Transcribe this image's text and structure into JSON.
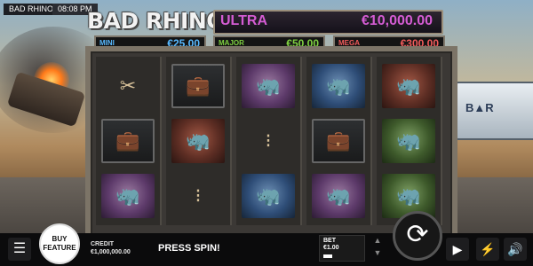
{
  "game": {
    "title": "BAD RHINOS",
    "time": "08:08 PM",
    "logo": "BAD RHINOS"
  },
  "jackpots": {
    "ultra": {
      "label": "ULTRA",
      "value": "€10,000.00"
    },
    "mini": {
      "label": "MINI",
      "value": "€25.00"
    },
    "major": {
      "label": "MAJOR",
      "value": "€50.00"
    },
    "mega": {
      "label": "MEGA",
      "value": "€300.00"
    }
  },
  "reels": [
    [
      "bolt-cutters",
      "briefcase",
      "rhino-purple-bullets"
    ],
    [
      "briefcase",
      "rhino-red-suit",
      "ammo-bullets"
    ],
    [
      "rhino-purple-bullets",
      "ammo-bullets",
      "rhino-blue-gunner"
    ],
    [
      "rhino-blue-driver",
      "briefcase",
      "rhino-purple-bullets"
    ],
    [
      "rhino-red-suit",
      "rhino-green-hacker",
      "rhino-green-hacker"
    ]
  ],
  "bottom": {
    "buy_feature": "BUY FEATURE",
    "credit_label": "CREDIT",
    "credit_value": "€1,000,000.00",
    "message": "PRESS SPIN!",
    "bet_label": "BET",
    "bet_value": "€1.00"
  },
  "icons": [
    "hamburger-icon",
    "spin-icon",
    "autoplay-icon",
    "turbo-icon",
    "sound-icon",
    "chevron-up-icon",
    "chevron-down-icon"
  ]
}
